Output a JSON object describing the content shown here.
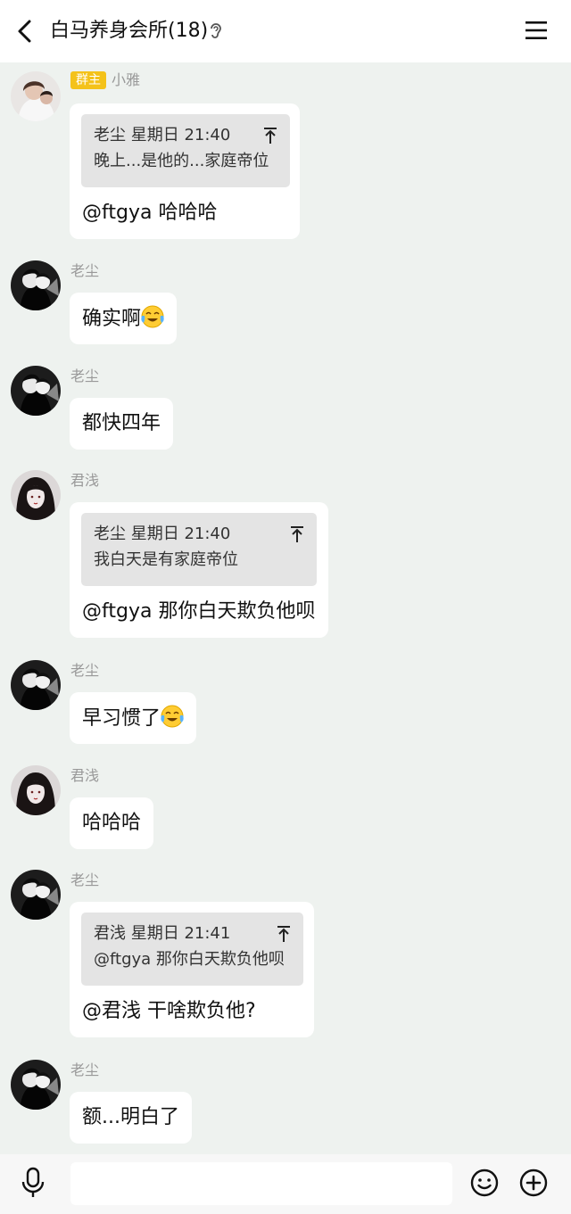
{
  "header": {
    "title": "白马养身会所(18)",
    "back_icon": "chevron-left-icon",
    "ear_icon": "ear-icon",
    "menu_icon": "menu-icon"
  },
  "messages": [
    {
      "sender": "小雅",
      "badge": "群主",
      "avatar": "avatar-girl-photo",
      "quote": {
        "header": "老尘 星期日 21:40",
        "text": "晚上...是他的...家庭帝位"
      },
      "text": "@ftgya 哈哈哈"
    },
    {
      "sender": "老尘",
      "avatar": "avatar-bw-illustration",
      "text": "确实啊",
      "emoji": "crying-laughing-emoji"
    },
    {
      "sender": "老尘",
      "avatar": "avatar-bw-illustration",
      "text": "都快四年"
    },
    {
      "sender": "君浅",
      "avatar": "avatar-dark-hair-girl",
      "quote": {
        "header": "老尘 星期日 21:40",
        "text": "我白天是有家庭帝位"
      },
      "text": "@ftgya 那你白天欺负他呗"
    },
    {
      "sender": "老尘",
      "avatar": "avatar-bw-illustration",
      "text": "早习惯了",
      "emoji": "crying-laughing-emoji"
    },
    {
      "sender": "君浅",
      "avatar": "avatar-dark-hair-girl",
      "text": "哈哈哈"
    },
    {
      "sender": "老尘",
      "avatar": "avatar-bw-illustration",
      "quote": {
        "header": "君浅 星期日 21:41",
        "text": "@ftgya 那你白天欺负他呗"
      },
      "text": "@君浅 干啥欺负他?"
    },
    {
      "sender": "老尘",
      "avatar": "avatar-bw-illustration",
      "text": "额...明白了"
    }
  ],
  "footer": {
    "mic_icon": "microphone-icon",
    "input_value": "",
    "emoji_icon": "smiley-icon",
    "plus_icon": "plus-circle-icon"
  },
  "colors": {
    "background": "#eef2ef",
    "bubble": "#ffffff",
    "quote_bg": "#e4e4e4",
    "badge": "#f4c21a",
    "sender_name": "#999999"
  }
}
